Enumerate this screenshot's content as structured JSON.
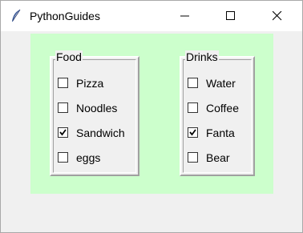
{
  "window": {
    "title": "PythonGuides"
  },
  "food": {
    "label": "Food",
    "items": [
      {
        "label": "Pizza",
        "checked": false
      },
      {
        "label": "Noodles",
        "checked": false
      },
      {
        "label": "Sandwich",
        "checked": true
      },
      {
        "label": "eggs",
        "checked": false
      }
    ]
  },
  "drinks": {
    "label": "Drinks",
    "items": [
      {
        "label": "Water",
        "checked": false
      },
      {
        "label": "Coffee",
        "checked": false
      },
      {
        "label": "Fanta",
        "checked": true
      },
      {
        "label": "Bear",
        "checked": false
      }
    ]
  },
  "colors": {
    "frame_bg": "#ccffcc",
    "window_bg": "#f0f0f0"
  }
}
